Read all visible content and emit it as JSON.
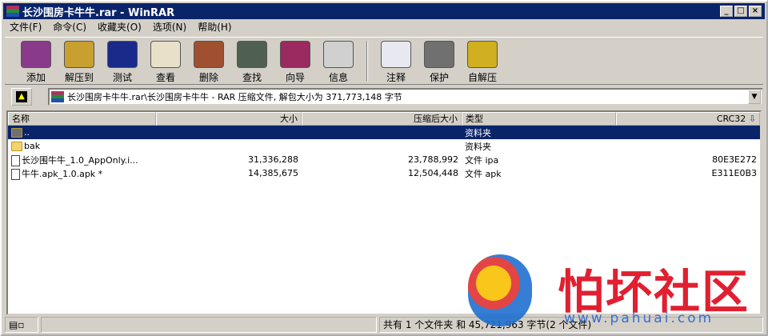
{
  "window": {
    "title": "长沙围房卡牛牛.rar - WinRAR",
    "controls": [
      "_",
      "□",
      "×"
    ]
  },
  "menu": [
    "文件(F)",
    "命令(C)",
    "收藏夹(O)",
    "选项(N)",
    "帮助(H)"
  ],
  "toolbar": [
    {
      "label": "添加",
      "icon": "add-archive-icon",
      "color": "#8a3a8a"
    },
    {
      "label": "解压到",
      "icon": "extract-icon",
      "color": "#c8a030"
    },
    {
      "label": "测试",
      "icon": "test-icon",
      "color": "#1a2a8a"
    },
    {
      "label": "查看",
      "icon": "view-icon",
      "color": "#e8e0c8"
    },
    {
      "label": "删除",
      "icon": "delete-icon",
      "color": "#a05030"
    },
    {
      "label": "查找",
      "icon": "find-icon",
      "color": "#506050"
    },
    {
      "label": "向导",
      "icon": "wizard-icon",
      "color": "#9a2a60"
    },
    {
      "label": "信息",
      "icon": "info-icon",
      "color": "#d0d0d0"
    },
    {
      "label": "注释",
      "icon": "comment-icon",
      "color": "#e8e8f0"
    },
    {
      "label": "保护",
      "icon": "protect-icon",
      "color": "#707070"
    },
    {
      "label": "自解压",
      "icon": "sfx-icon",
      "color": "#d0b020"
    }
  ],
  "address": {
    "path": "长沙围房卡牛牛.rar\\长沙围房卡牛牛 - RAR 压缩文件, 解包大小为 371,773,148 字节"
  },
  "columns": [
    "名称",
    "大小",
    "压缩后大小",
    "类型",
    "CRC32"
  ],
  "sort_indicator": "⇩",
  "rows": [
    {
      "name": "..",
      "size": "",
      "packed": "",
      "type": "资料夹",
      "crc": "",
      "kind": "up"
    },
    {
      "name": "bak",
      "size": "",
      "packed": "",
      "type": "资料夹",
      "crc": "",
      "kind": "folder"
    },
    {
      "name": "长沙围牛牛_1.0_AppOnly.i...",
      "size": "31,336,288",
      "packed": "23,788,992",
      "type": "文件 ipa",
      "crc": "80E3E272",
      "kind": "file"
    },
    {
      "name": "牛牛.apk_1.0.apk *",
      "size": "14,385,675",
      "packed": "12,504,448",
      "type": "文件 apk",
      "crc": "E311E0B3",
      "kind": "file"
    }
  ],
  "status": {
    "summary": "共有 1 个文件夹 和 45,721,963 字节(2 个文件)"
  },
  "watermark": {
    "text": "怕坏社区",
    "url": "www.pahuai.com"
  }
}
